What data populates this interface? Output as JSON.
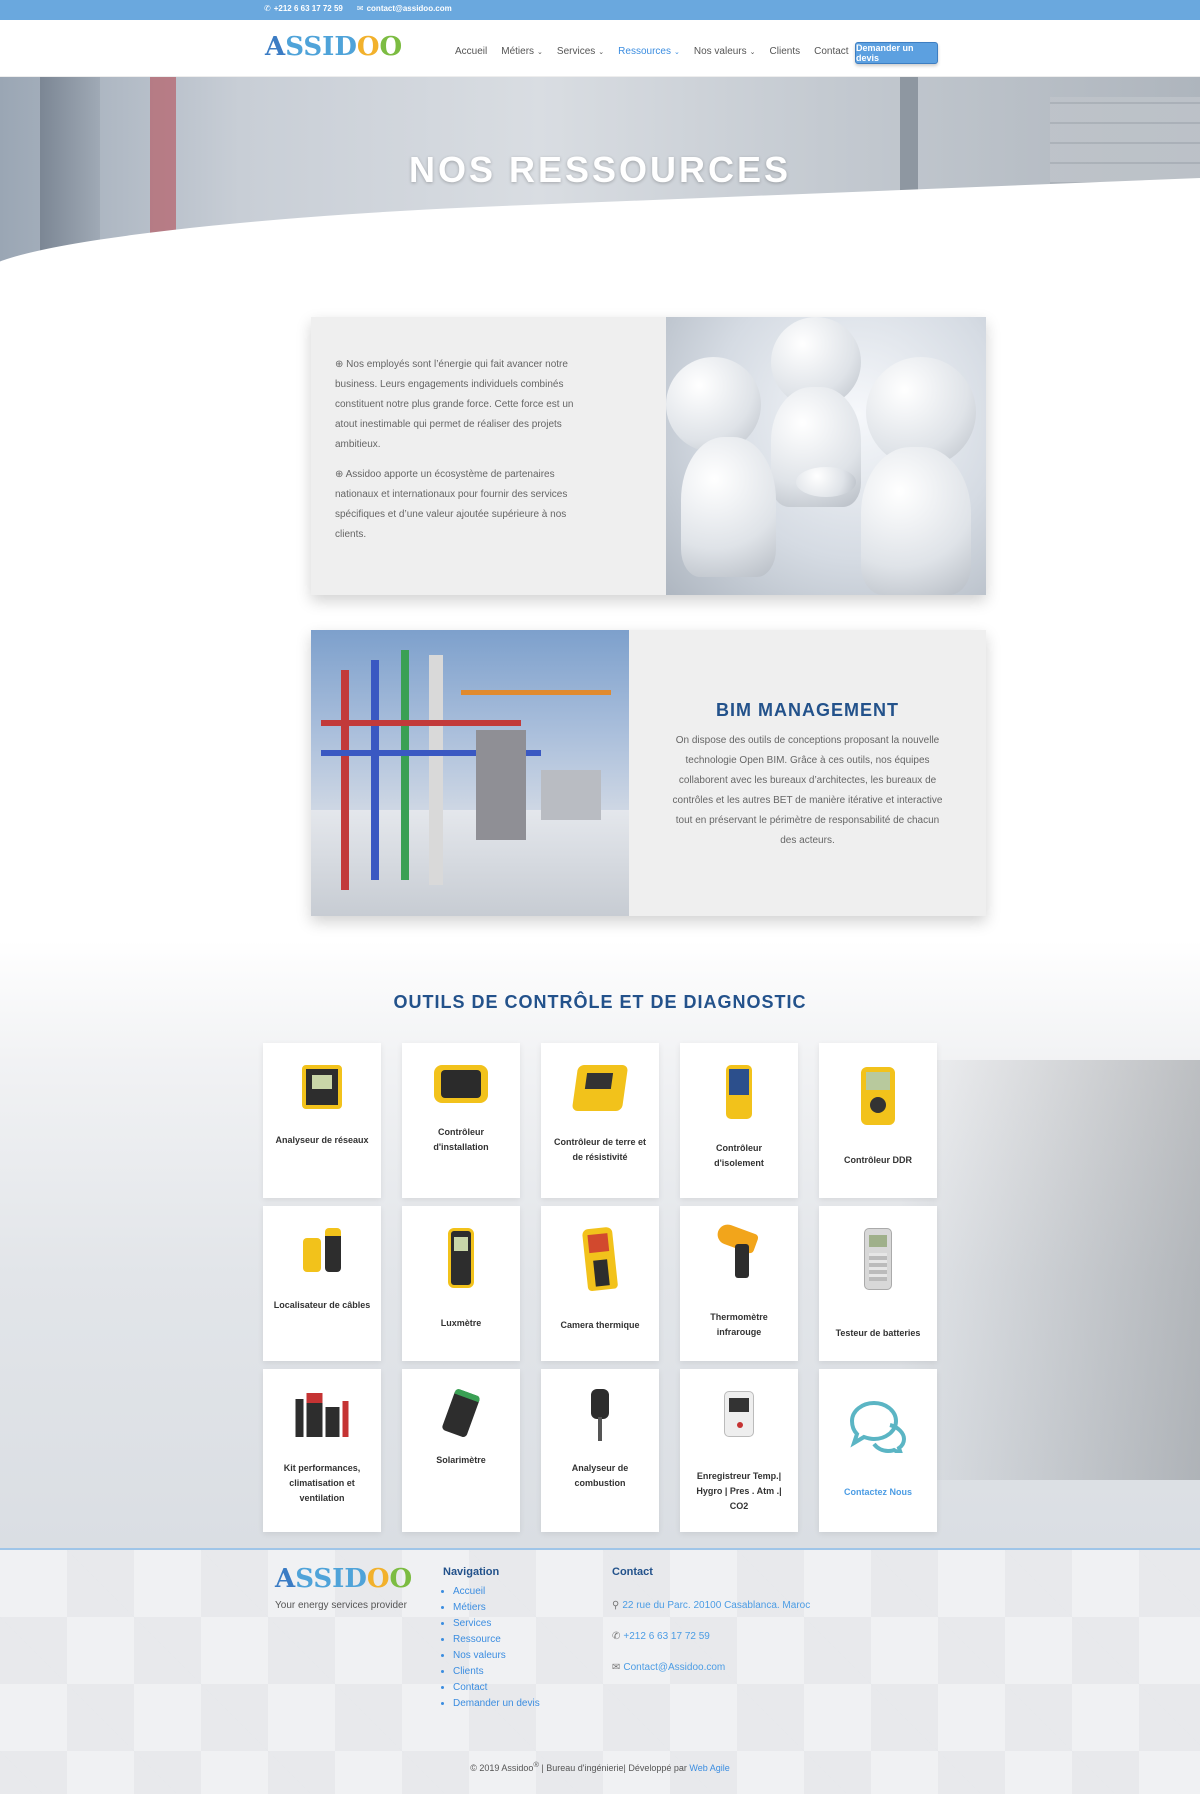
{
  "topbar": {
    "phone": "+212 6 63 17 72 59",
    "email": "contact@assidoo.com",
    "phone_icon": "phone-icon",
    "email_icon": "envelope-icon"
  },
  "header": {
    "logo": {
      "part1": "A",
      "part2": "SSID",
      "part3": "O",
      "part4": "O"
    },
    "nav": [
      {
        "label": "Accueil",
        "dropdown": false,
        "active": false
      },
      {
        "label": "Métiers",
        "dropdown": true,
        "active": false
      },
      {
        "label": "Services",
        "dropdown": true,
        "active": false
      },
      {
        "label": "Ressources",
        "dropdown": true,
        "active": true
      },
      {
        "label": "Nos valeurs",
        "dropdown": true,
        "active": false
      },
      {
        "label": "Clients",
        "dropdown": false,
        "active": false
      },
      {
        "label": "Contact",
        "dropdown": false,
        "active": false
      }
    ],
    "cta": "Demander un devis"
  },
  "hero": {
    "title": "NOS RESSOURCES"
  },
  "section1": {
    "p1": "⊕ Nos employés sont l’énergie qui fait avancer notre business. Leurs engagements individuels combinés constituent notre plus grande force. Cette force est un atout inestimable qui permet de réaliser des projets ambitieux.",
    "p2": "⊕ Assidoo apporte un écosystème de partenaires nationaux et internationaux pour fournir des services spécifiques et d’une valeur ajoutée supérieure à nos clients."
  },
  "section2": {
    "title": "BIM MANAGEMENT",
    "desc": "On dispose des outils de conceptions proposant la nouvelle  technologie Open BIM. Grâce à ces outils, nos équipes collaborent avec les bureaux d’architectes, les bureaux de contrôles et les autres BET de manière itérative et interactive tout en préservant le périmètre de responsabilité de chacun des acteurs."
  },
  "tools": {
    "title": "OUTILS DE CONTRÔLE ET DE DIAGNOSTIC",
    "items": [
      {
        "label": "Analyseur de réseaux",
        "icon": "network-analyzer-icon"
      },
      {
        "label": "Contrôleur d'installation",
        "icon": "installation-tester-icon"
      },
      {
        "label": "Contrôleur de terre et de résistivité",
        "icon": "earth-tester-icon"
      },
      {
        "label": "Contrôleur d'isolement",
        "icon": "insulation-tester-icon"
      },
      {
        "label": "Contrôleur DDR",
        "icon": "rcd-tester-icon"
      },
      {
        "label": "Localisateur de câbles",
        "icon": "cable-locator-icon"
      },
      {
        "label": "Luxmètre",
        "icon": "luxmeter-icon"
      },
      {
        "label": "Camera thermique",
        "icon": "thermal-camera-icon"
      },
      {
        "label": "Thermomètre infrarouge",
        "icon": "ir-thermometer-icon"
      },
      {
        "label": "Testeur de batteries",
        "icon": "battery-tester-icon"
      },
      {
        "label": "Kit performances, climatisation et ventilation",
        "icon": "hvac-kit-icon"
      },
      {
        "label": "Solarimètre",
        "icon": "solarimeter-icon"
      },
      {
        "label": "Analyseur de combustion",
        "icon": "combustion-analyzer-icon"
      },
      {
        "label": "Enregistreur Temp.| Hygro | Pres . Atm .| CO2",
        "icon": "data-logger-icon"
      },
      {
        "label": "Contactez Nous",
        "icon": "chat-bubbles-icon"
      }
    ]
  },
  "footer": {
    "tagline": "Your energy services provider",
    "nav_title": "Navigation",
    "nav": [
      "Accueil",
      "Métiers",
      "Services",
      "Ressource",
      "Nos valeurs",
      "Clients",
      "Contact",
      "Demander un devis"
    ],
    "contact_title": "Contact",
    "address": "22 rue du Parc. 20100 Casablanca. Maroc",
    "phone": "+212 6 63 17 72 59",
    "email": "Contact@Assidoo.com",
    "copy_prefix": "© 2019 Assidoo",
    "copy_reg": "®",
    "copy_middle": " | Bureau d'ingénierie| Développé par ",
    "copy_link": "Web Agile"
  },
  "colors": {
    "accent": "#3b8de0",
    "heading": "#23528b",
    "topbar": "#6aa8de"
  }
}
